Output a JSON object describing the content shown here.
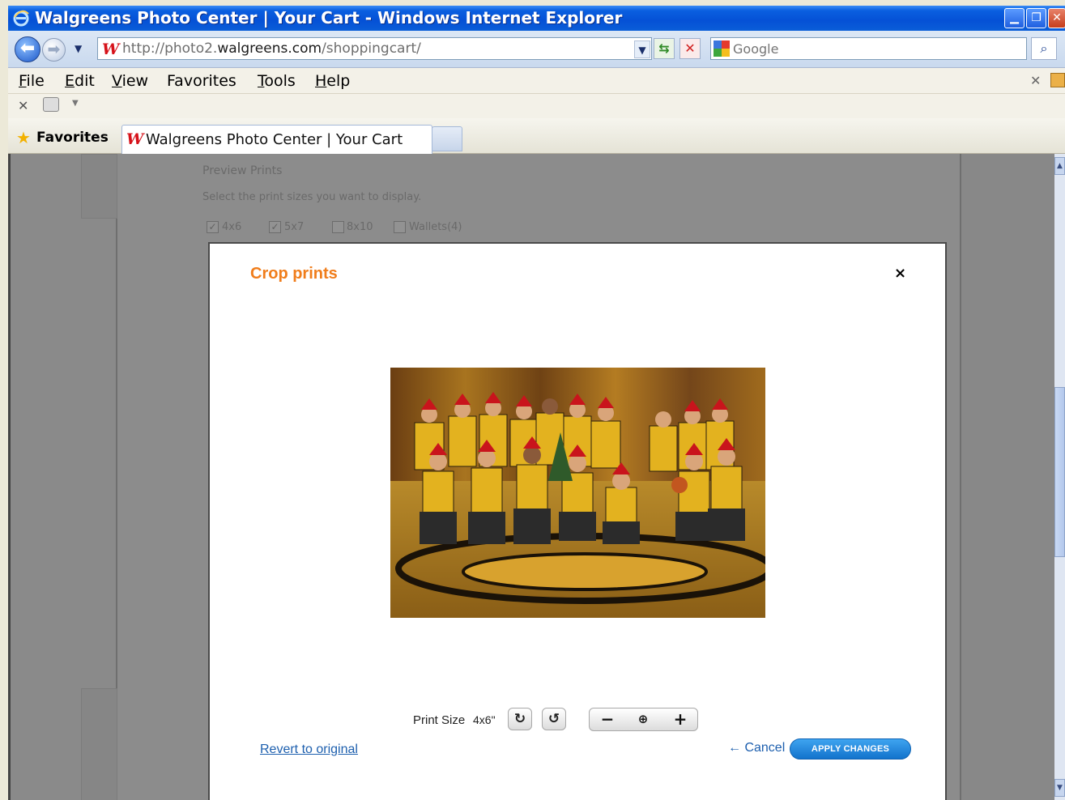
{
  "window": {
    "title": "Walgreens Photo Center | Your Cart - Windows Internet Explorer"
  },
  "addressbar": {
    "url_prefix": "http://photo2.",
    "url_domain": "walgreens.com",
    "url_path": "/shoppingcart/",
    "search_placeholder": "Google"
  },
  "menu": {
    "items": [
      {
        "first": "F",
        "rest": "ile"
      },
      {
        "first": "E",
        "rest": "dit"
      },
      {
        "first": "V",
        "rest": "iew"
      },
      {
        "first": "Fa",
        "rest": "vorites"
      },
      {
        "first": "T",
        "rest": "ools"
      },
      {
        "first": "H",
        "rest": "elp"
      }
    ]
  },
  "favorites": {
    "label": "Favorites",
    "active_tab": "Walgreens Photo Center | Your Cart"
  },
  "background_page": {
    "preview_heading": "Preview Prints",
    "preview_instructions": "Select the print sizes you want to display.",
    "size_options": [
      {
        "label": "4x6",
        "checked": true
      },
      {
        "label": "5x7",
        "checked": true
      },
      {
        "label": "8x10",
        "checked": false
      },
      {
        "label": "Wallets(4)",
        "checked": false
      }
    ]
  },
  "modal": {
    "title": "Crop prints",
    "close_symbol": "×",
    "print_size_label": "Print Size",
    "print_size_value": "4x6\"",
    "revert_label": "Revert to original",
    "cancel_label": "Cancel",
    "apply_label": "APPLY CHANGES"
  },
  "colors": {
    "accent_title": "#f07d1b",
    "link": "#1d5fae",
    "apply_button": "#1f86dd",
    "overlay": "#6f6f6f"
  }
}
